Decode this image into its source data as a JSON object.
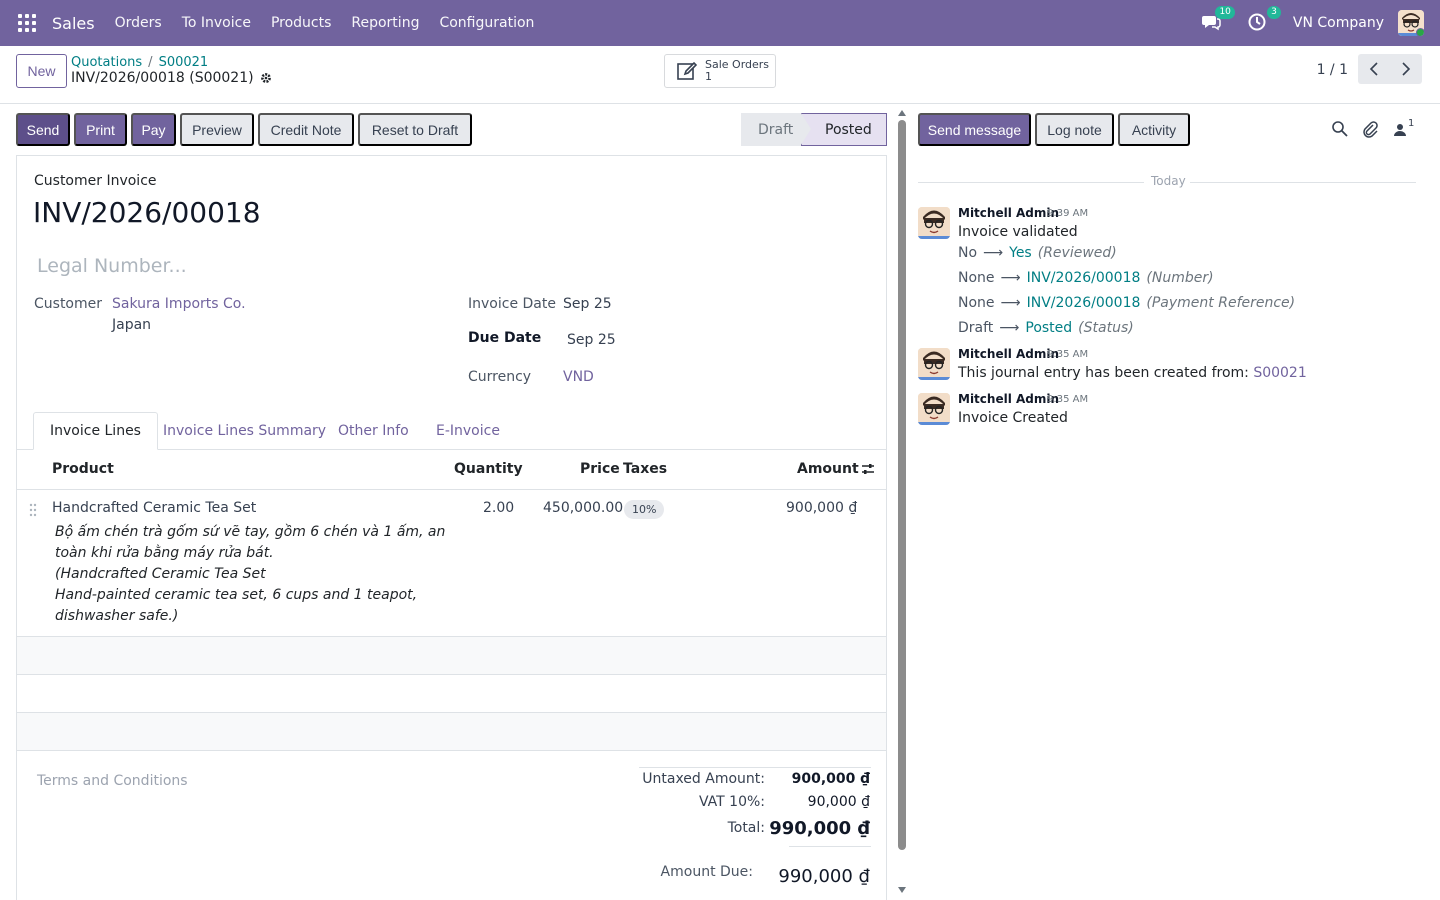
{
  "navbar": {
    "app_name": "Sales",
    "menu": [
      "Orders",
      "To Invoice",
      "Products",
      "Reporting",
      "Configuration"
    ],
    "messages_count": "10",
    "activities_count": "3",
    "company": "VN Company",
    "color": "#71639e"
  },
  "control": {
    "new_label": "New",
    "breadcrumb": [
      "Quotations",
      "S00021"
    ],
    "record_title": "INV/2026/00018 (S00021)",
    "smart_button": {
      "label": "Sale Orders",
      "count": "1"
    },
    "pager": "1 / 1"
  },
  "actions": {
    "send": "Send",
    "print": "Print",
    "pay": "Pay",
    "preview": "Preview",
    "credit_note": "Credit Note",
    "reset": "Reset to Draft"
  },
  "status": {
    "draft": "Draft",
    "posted": "Posted"
  },
  "form": {
    "type_label": "Customer Invoice",
    "number": "INV/2026/00018",
    "legal_placeholder": "Legal Number...",
    "customer_label": "Customer",
    "customer_name": "Sakura Imports Co.",
    "customer_country": "Japan",
    "invoice_date_label": "Invoice Date",
    "invoice_date": "Sep 25",
    "due_date_label": "Due Date",
    "due_date": "Sep 25",
    "currency_label": "Currency",
    "currency": "VND"
  },
  "tabs": [
    "Invoice Lines",
    "Invoice Lines Summary",
    "Other Info",
    "E-Invoice"
  ],
  "lines": {
    "headers": {
      "product": "Product",
      "quantity": "Quantity",
      "price": "Price",
      "taxes": "Taxes",
      "amount": "Amount"
    },
    "rows": [
      {
        "product": "Handcrafted Ceramic Tea Set",
        "description": [
          "Bộ ấm chén trà gốm sứ vẽ tay, gồm 6 chén và 1 ấm, an",
          "toàn khi rửa bằng máy rửa bát.",
          "(Handcrafted Ceramic Tea Set",
          "Hand-painted ceramic tea set, 6 cups and 1 teapot,",
          "dishwasher safe.)"
        ],
        "quantity": "2.00",
        "price": "450,000.00",
        "tax": "10%",
        "amount": "900,000 ₫"
      }
    ]
  },
  "totals": {
    "terms_placeholder": "Terms and Conditions",
    "untaxed_label": "Untaxed Amount:",
    "untaxed": "900,000 ₫",
    "vat_label": "VAT 10%:",
    "vat": "90,000 ₫",
    "total_label": "Total:",
    "total": "990,000 ₫",
    "due_label": "Amount Due:",
    "due": "990,000 ₫"
  },
  "chatter": {
    "send_message": "Send message",
    "log_note": "Log note",
    "activity": "Activity",
    "followers_count": "1",
    "date_separator": "Today",
    "messages": [
      {
        "author": "Mitchell Admin",
        "time": "9:39 AM",
        "body": "Invoice validated",
        "tracking": [
          {
            "old": "No",
            "new": "Yes",
            "field": "(Reviewed)"
          },
          {
            "old": "None",
            "new": "INV/2026/00018",
            "field": "(Number)"
          },
          {
            "old": "None",
            "new": "INV/2026/00018",
            "field": "(Payment Reference)"
          },
          {
            "old": "Draft",
            "new": "Posted",
            "field": "(Status)"
          }
        ]
      },
      {
        "author": "Mitchell Admin",
        "time": "9:35 AM",
        "body": "This journal entry has been created from:",
        "link": "S00021"
      },
      {
        "author": "Mitchell Admin",
        "time": "9:35 AM",
        "body": "Invoice Created"
      }
    ]
  }
}
